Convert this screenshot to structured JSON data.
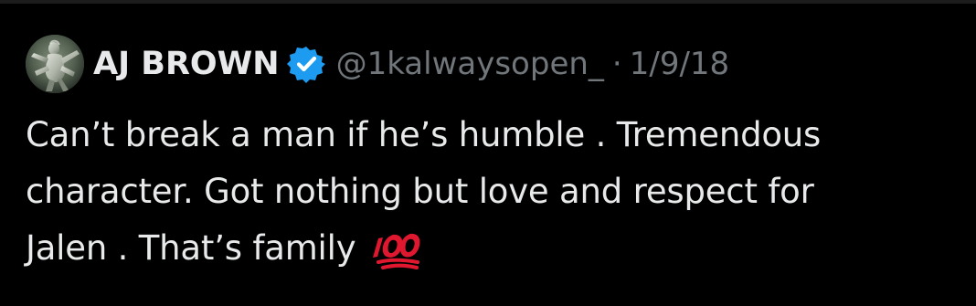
{
  "tweet": {
    "author": {
      "display_name": "AJ BROWN",
      "handle": "@1kalwaysopen_",
      "verified": true,
      "avatar_icon": "statue-avatar"
    },
    "separator": "·",
    "date": "1/9/18",
    "text_lines": [
      "Can’t break a man if he’s humble . Tremendous",
      "character. Got nothing but love and respect for",
      "Jalen . That’s family"
    ],
    "emoji": "100-icon"
  },
  "colors": {
    "background": "#000000",
    "text": "#e7e9ea",
    "secondary_text": "#71767b",
    "verified_blue": "#1d9bf0",
    "emoji_red": "#e0182f"
  }
}
